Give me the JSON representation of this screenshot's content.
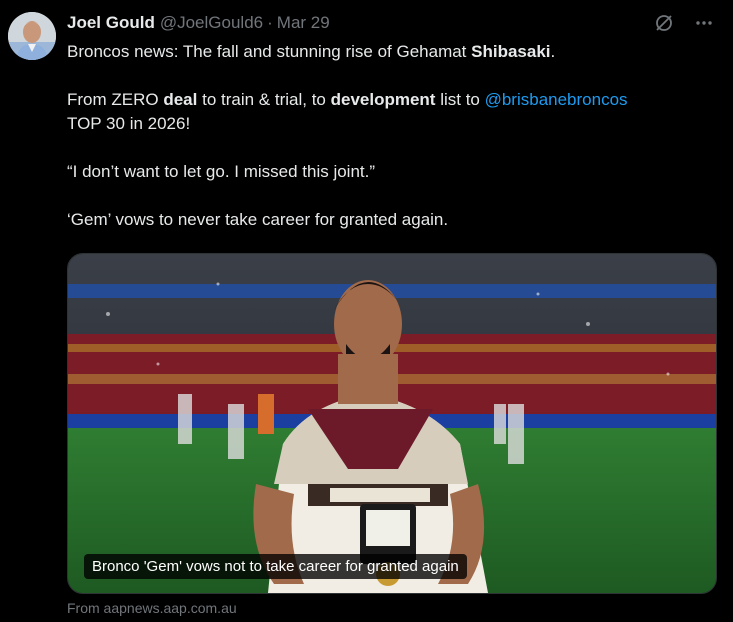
{
  "author": {
    "name": "Joel Gould",
    "handle": "@JoelGould6",
    "separator": "·",
    "date": "Mar 29"
  },
  "icons": {
    "avatar": "person-avatar",
    "grok": "grok-icon",
    "more": "more-icon"
  },
  "tweet": {
    "line1_pre": "Broncos news: The fall and stunning rise of Gehamat ",
    "line1_bold": "Shibasaki",
    "line1_post": ".",
    "line2_pre": "From ZERO ",
    "line2_bold1": "deal",
    "line2_mid": " to train & trial, to ",
    "line2_bold2": "development",
    "line2_post": " list to ",
    "line2_mention": "@brisbanebroncos",
    "line3": "TOP 30 in 2026!",
    "quote": "“I don’t want to let go. I missed this joint.”",
    "line5": "‘Gem’ vows to never take career for granted again."
  },
  "card": {
    "caption": "Bronco 'Gem' vows not to take career for granted again",
    "source": "From aapnews.aap.com.au"
  },
  "colors": {
    "background": "#000000",
    "text": "#e7e9ea",
    "secondary": "#71767b",
    "link": "#1d9bf0"
  }
}
